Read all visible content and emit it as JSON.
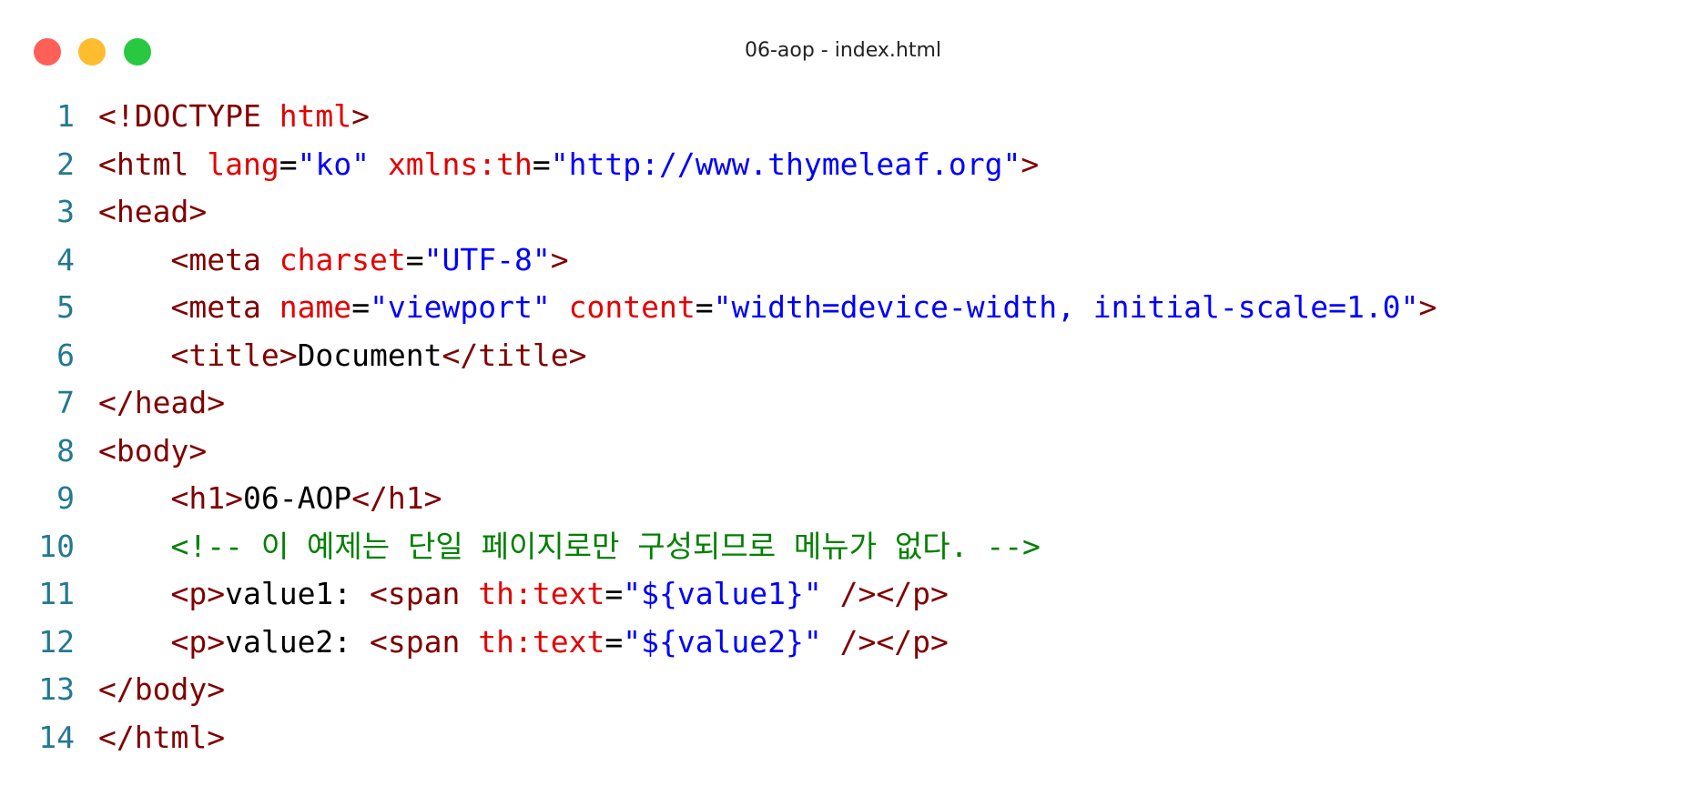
{
  "window": {
    "title": "06-aop - index.html",
    "controls": {
      "close_color": "#fe5f57",
      "minimize_color": "#febc2e",
      "zoom_color": "#28c840"
    }
  },
  "syntax_colors": {
    "line_number": "#237893",
    "tag": "#800000",
    "attribute": "#e50000",
    "string": "#0000ff",
    "text": "#000000",
    "comment": "#008000"
  },
  "code": {
    "lines": [
      {
        "number": "1",
        "tokens": [
          {
            "t": "tag",
            "v": "<!DOCTYPE "
          },
          {
            "t": "attr",
            "v": "html"
          },
          {
            "t": "tag",
            "v": ">"
          }
        ]
      },
      {
        "number": "2",
        "tokens": [
          {
            "t": "tag",
            "v": "<html "
          },
          {
            "t": "attr",
            "v": "lang"
          },
          {
            "t": "txt",
            "v": "="
          },
          {
            "t": "str",
            "v": "\"ko\""
          },
          {
            "t": "txt",
            "v": " "
          },
          {
            "t": "attr",
            "v": "xmlns:th"
          },
          {
            "t": "txt",
            "v": "="
          },
          {
            "t": "str",
            "v": "\"http://www.thymeleaf.org\""
          },
          {
            "t": "tag",
            "v": ">"
          }
        ]
      },
      {
        "number": "3",
        "tokens": [
          {
            "t": "tag",
            "v": "<head>"
          }
        ]
      },
      {
        "number": "4",
        "tokens": [
          {
            "t": "txt",
            "v": "    "
          },
          {
            "t": "tag",
            "v": "<meta "
          },
          {
            "t": "attr",
            "v": "charset"
          },
          {
            "t": "txt",
            "v": "="
          },
          {
            "t": "str",
            "v": "\"UTF-8\""
          },
          {
            "t": "tag",
            "v": ">"
          }
        ]
      },
      {
        "number": "5",
        "tokens": [
          {
            "t": "txt",
            "v": "    "
          },
          {
            "t": "tag",
            "v": "<meta "
          },
          {
            "t": "attr",
            "v": "name"
          },
          {
            "t": "txt",
            "v": "="
          },
          {
            "t": "str",
            "v": "\"viewport\""
          },
          {
            "t": "txt",
            "v": " "
          },
          {
            "t": "attr",
            "v": "content"
          },
          {
            "t": "txt",
            "v": "="
          },
          {
            "t": "str",
            "v": "\"width=device-width, initial-scale=1.0\""
          },
          {
            "t": "tag",
            "v": ">"
          }
        ]
      },
      {
        "number": "6",
        "tokens": [
          {
            "t": "txt",
            "v": "    "
          },
          {
            "t": "tag",
            "v": "<title>"
          },
          {
            "t": "txt",
            "v": "Document"
          },
          {
            "t": "tag",
            "v": "</title>"
          }
        ]
      },
      {
        "number": "7",
        "tokens": [
          {
            "t": "tag",
            "v": "</head>"
          }
        ]
      },
      {
        "number": "8",
        "tokens": [
          {
            "t": "tag",
            "v": "<body>"
          }
        ]
      },
      {
        "number": "9",
        "tokens": [
          {
            "t": "txt",
            "v": "    "
          },
          {
            "t": "tag",
            "v": "<h1>"
          },
          {
            "t": "txt",
            "v": "06-AOP"
          },
          {
            "t": "tag",
            "v": "</h1>"
          }
        ]
      },
      {
        "number": "10",
        "tokens": [
          {
            "t": "txt",
            "v": "    "
          },
          {
            "t": "com",
            "v": "<!-- 이 예제는 단일 페이지로만 구성되므로 메뉴가 없다. -->"
          }
        ]
      },
      {
        "number": "11",
        "tokens": [
          {
            "t": "txt",
            "v": "    "
          },
          {
            "t": "tag",
            "v": "<p>"
          },
          {
            "t": "txt",
            "v": "value1: "
          },
          {
            "t": "tag",
            "v": "<span "
          },
          {
            "t": "attr",
            "v": "th:text"
          },
          {
            "t": "txt",
            "v": "="
          },
          {
            "t": "str",
            "v": "\"${value1}\""
          },
          {
            "t": "txt",
            "v": " "
          },
          {
            "t": "tag",
            "v": "/></p>"
          }
        ]
      },
      {
        "number": "12",
        "tokens": [
          {
            "t": "txt",
            "v": "    "
          },
          {
            "t": "tag",
            "v": "<p>"
          },
          {
            "t": "txt",
            "v": "value2: "
          },
          {
            "t": "tag",
            "v": "<span "
          },
          {
            "t": "attr",
            "v": "th:text"
          },
          {
            "t": "txt",
            "v": "="
          },
          {
            "t": "str",
            "v": "\"${value2}\""
          },
          {
            "t": "txt",
            "v": " "
          },
          {
            "t": "tag",
            "v": "/></p>"
          }
        ]
      },
      {
        "number": "13",
        "tokens": [
          {
            "t": "tag",
            "v": "</body>"
          }
        ]
      },
      {
        "number": "14",
        "tokens": [
          {
            "t": "tag",
            "v": "</html>"
          }
        ]
      }
    ]
  }
}
